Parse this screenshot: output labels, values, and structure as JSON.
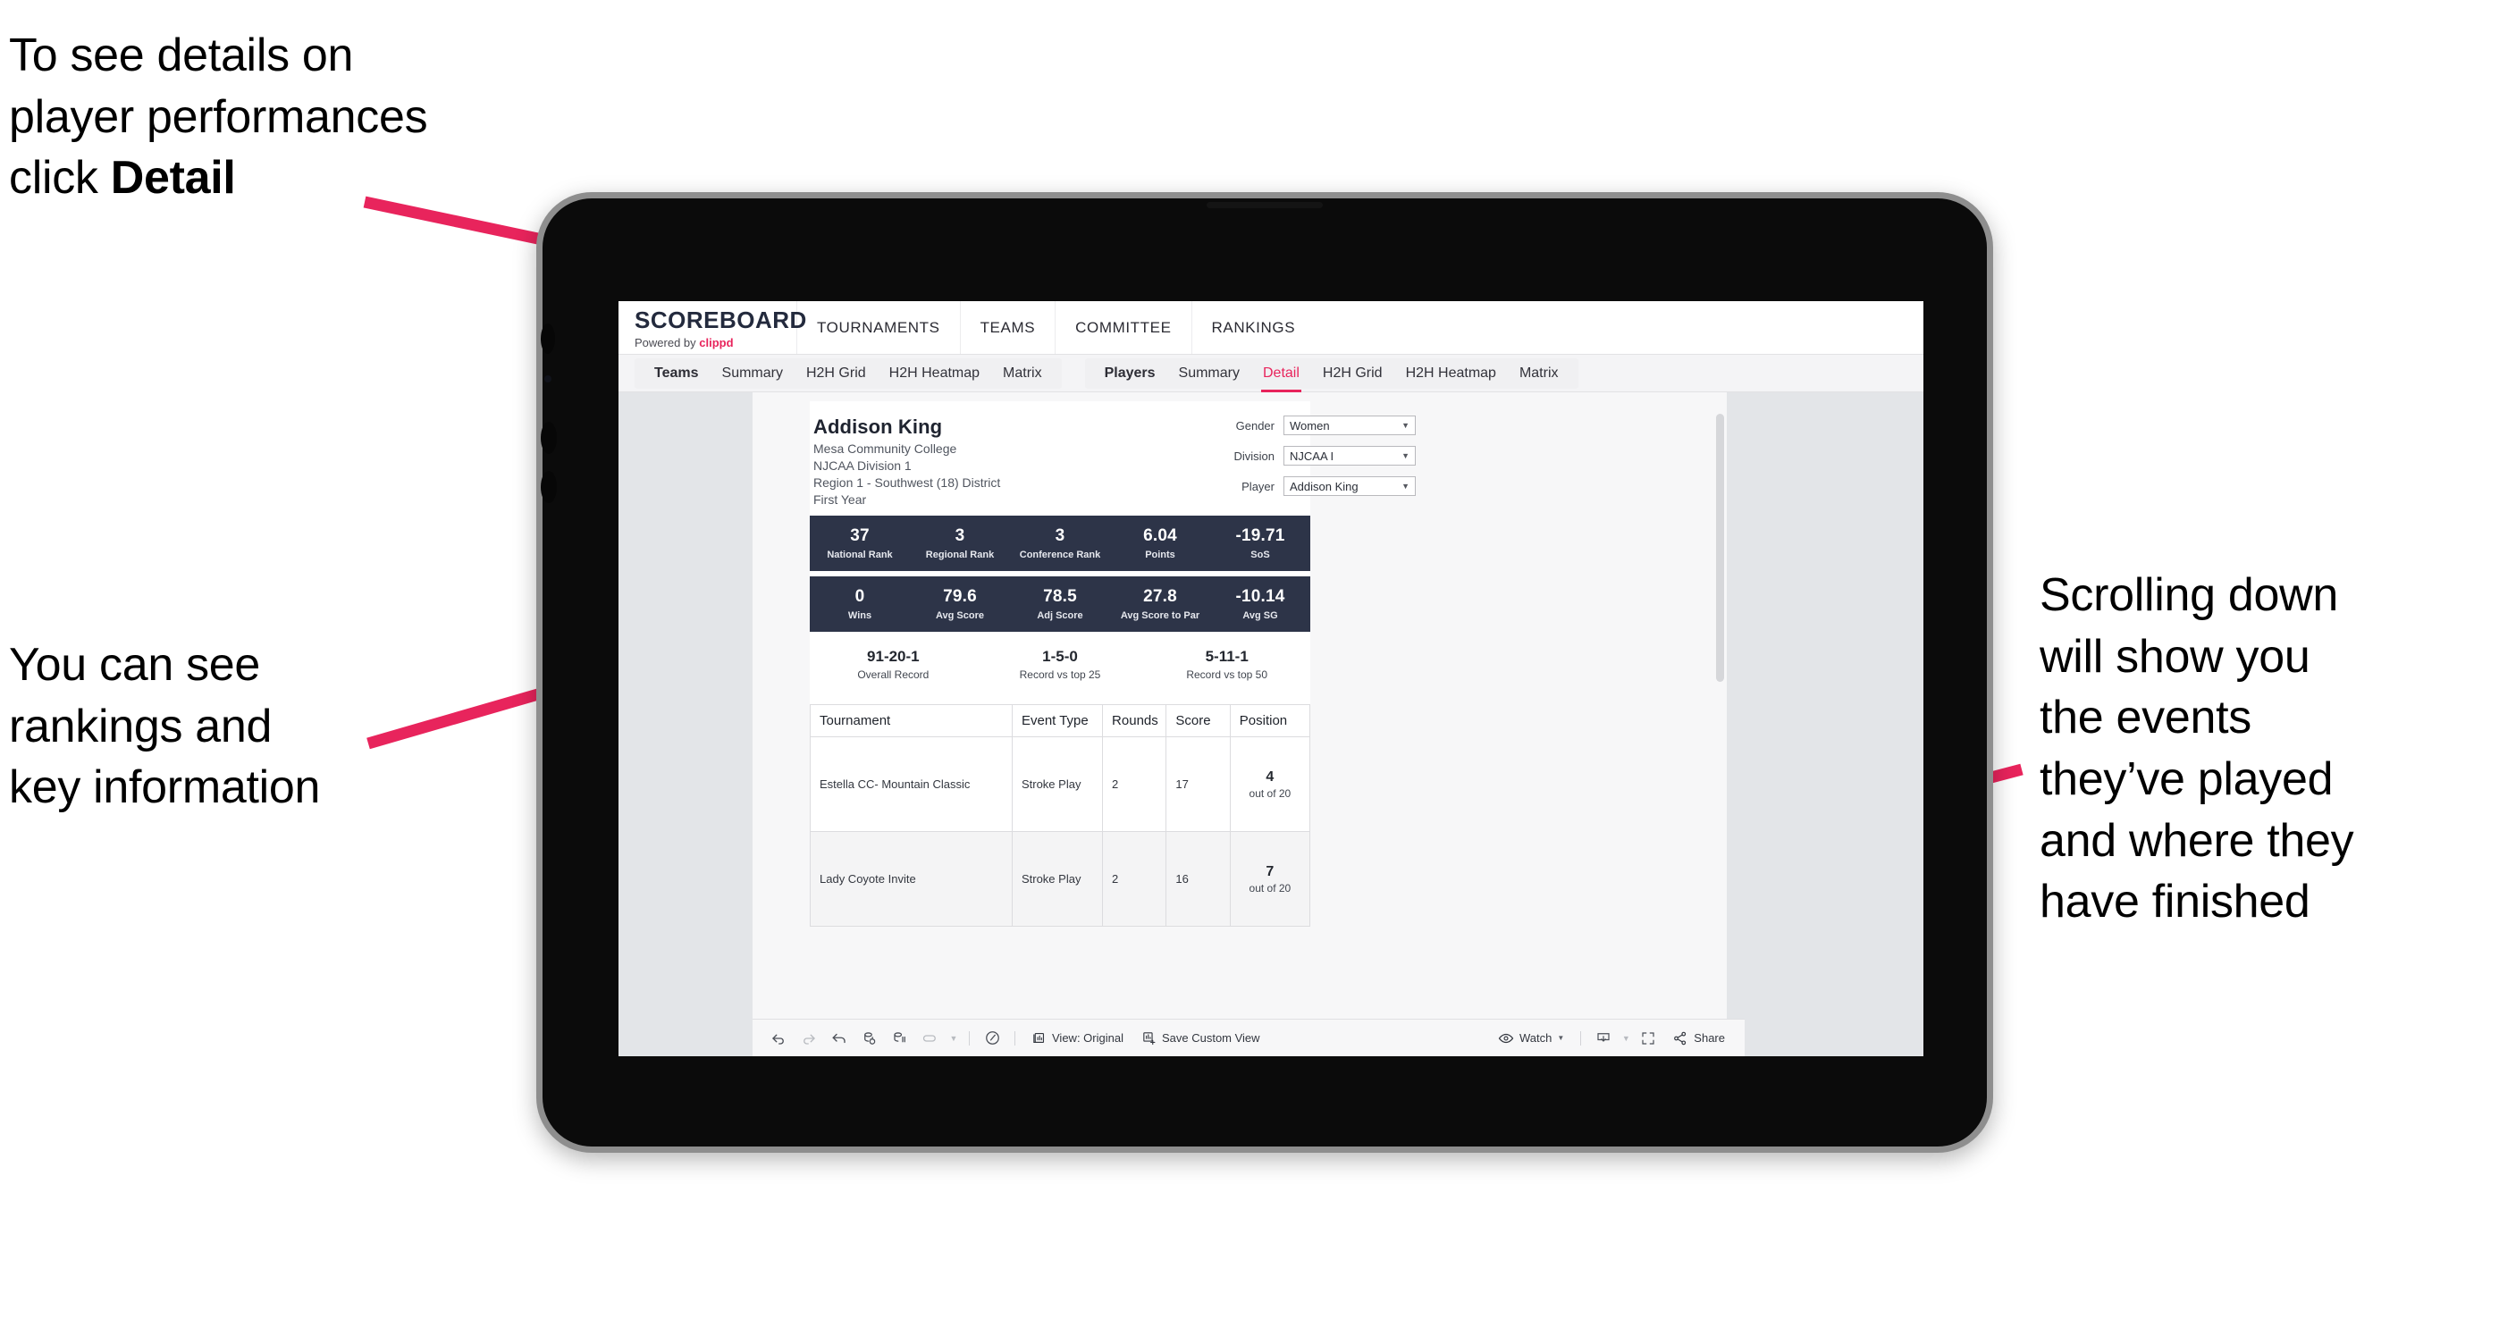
{
  "annotations": {
    "detail_note": "To see details on\nplayer performances\nclick ",
    "detail_note_bold": "Detail",
    "rankings_note": "You can see\nrankings and\nkey information",
    "scroll_note": "Scrolling down\nwill show you\nthe events\nthey’ve played\nand where they\nhave finished",
    "arrow_color": "#e8245c"
  },
  "app": {
    "brand": {
      "title": "SCOREBOARD",
      "powered_prefix": "Powered by ",
      "powered_brand": "clippd"
    },
    "topnav": [
      {
        "label": "TOURNAMENTS"
      },
      {
        "label": "TEAMS"
      },
      {
        "label": "COMMITTEE"
      },
      {
        "label": "RANKINGS"
      }
    ],
    "subnav": {
      "group_teams": [
        {
          "label": "Teams"
        },
        {
          "label": "Summary"
        },
        {
          "label": "H2H Grid"
        },
        {
          "label": "H2H Heatmap"
        },
        {
          "label": "Matrix"
        }
      ],
      "group_players": [
        {
          "label": "Players"
        },
        {
          "label": "Summary"
        },
        {
          "label": "Detail",
          "active": true
        },
        {
          "label": "H2H Grid"
        },
        {
          "label": "H2H Heatmap"
        },
        {
          "label": "Matrix"
        }
      ]
    },
    "player": {
      "name": "Addison King",
      "school": "Mesa Community College",
      "division": "NJCAA Division 1",
      "region": "Region 1 - Southwest (18) District",
      "year": "First Year"
    },
    "filters": [
      {
        "label": "Gender",
        "value": "Women"
      },
      {
        "label": "Division",
        "value": "NJCAA I"
      },
      {
        "label": "Player",
        "value": "Addison King"
      }
    ],
    "stats_row1": [
      {
        "value": "37",
        "label": "National Rank"
      },
      {
        "value": "3",
        "label": "Regional Rank"
      },
      {
        "value": "3",
        "label": "Conference Rank"
      },
      {
        "value": "6.04",
        "label": "Points"
      },
      {
        "value": "-19.71",
        "label": "SoS"
      }
    ],
    "stats_row2": [
      {
        "value": "0",
        "label": "Wins"
      },
      {
        "value": "79.6",
        "label": "Avg Score"
      },
      {
        "value": "78.5",
        "label": "Adj Score"
      },
      {
        "value": "27.8",
        "label": "Avg Score to Par"
      },
      {
        "value": "-10.14",
        "label": "Avg SG"
      }
    ],
    "records": [
      {
        "value": "91-20-1",
        "label": "Overall Record"
      },
      {
        "value": "1-5-0",
        "label": "Record vs top 25"
      },
      {
        "value": "5-11-1",
        "label": "Record vs top 50"
      }
    ],
    "table": {
      "columns": [
        "Tournament",
        "Event Type",
        "Rounds",
        "Score",
        "Position"
      ],
      "rows": [
        {
          "tournament": "Estella CC- Mountain Classic",
          "event_type": "Stroke Play",
          "rounds": "2",
          "score": "17",
          "position_num": "4",
          "position_of": "out of 20"
        },
        {
          "tournament": "Lady Coyote Invite",
          "event_type": "Stroke Play",
          "rounds": "2",
          "score": "16",
          "position_num": "7",
          "position_of": "out of 20"
        }
      ]
    },
    "toolbar": {
      "view_label": "View: Original",
      "save_label": "Save Custom View",
      "watch_label": "Watch",
      "share_label": "Share"
    },
    "colors": {
      "accent_pink": "#e8245c",
      "stat_navy": "#2d3448",
      "screen_bg": "#e3e5e8"
    }
  }
}
